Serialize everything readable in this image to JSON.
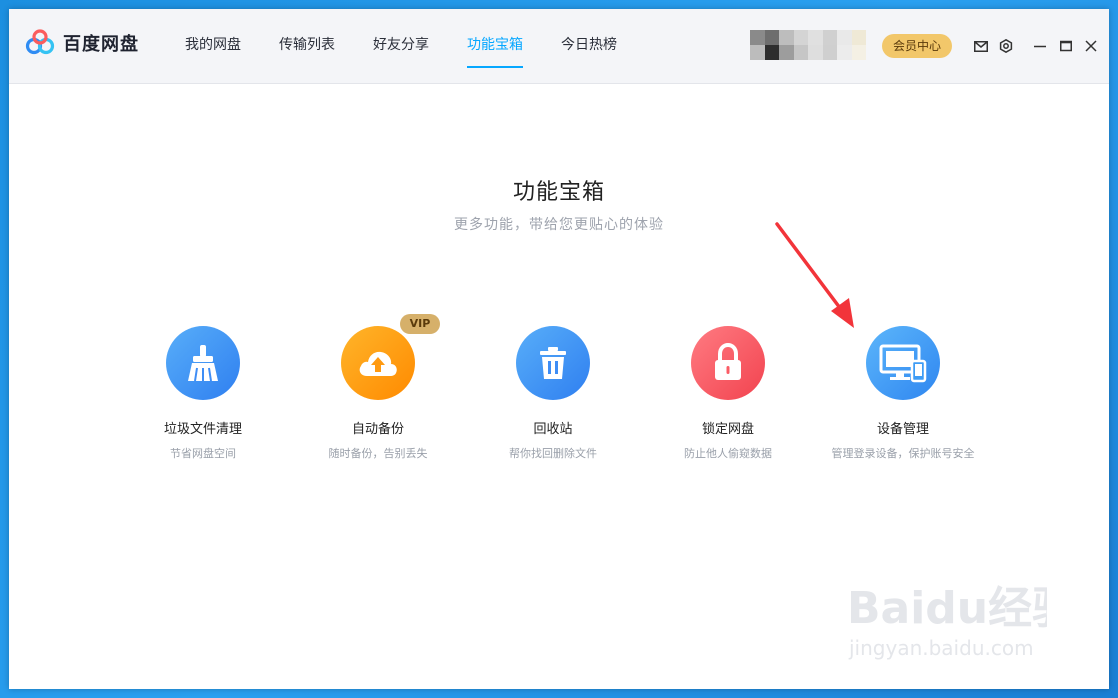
{
  "app": {
    "name": "百度网盘"
  },
  "nav": [
    {
      "label": "我的网盘",
      "active": false
    },
    {
      "label": "传输列表",
      "active": false
    },
    {
      "label": "好友分享",
      "active": false
    },
    {
      "label": "功能宝箱",
      "active": true
    },
    {
      "label": "今日热榜",
      "active": false
    }
  ],
  "header": {
    "vip_center": "会员中心"
  },
  "page": {
    "title": "功能宝箱",
    "subtitle": "更多功能，带给您更贴心的体验"
  },
  "features": [
    {
      "label": "垃圾文件清理",
      "desc": "节省网盘空间",
      "icon": "broom-icon",
      "color": "#3e8df5"
    },
    {
      "label": "自动备份",
      "desc": "随时备份，告别丢失",
      "icon": "cloud-upload-icon",
      "color": "#ff9f0f",
      "badge": "VIP"
    },
    {
      "label": "回收站",
      "desc": "帮你找回删除文件",
      "icon": "trash-icon",
      "color": "#3e8df5"
    },
    {
      "label": "锁定网盘",
      "desc": "防止他人偷窥数据",
      "icon": "lock-icon",
      "color": "#fb5c66"
    },
    {
      "label": "设备管理",
      "desc": "管理登录设备，保护账号安全",
      "icon": "devices-icon",
      "color": "#3e9cf5"
    }
  ],
  "watermark": {
    "brand": "Baidu经验",
    "url": "jingyan.baidu.com"
  },
  "colors": {
    "accent": "#06a7ff",
    "arrow": "#f2343a",
    "vip": "#f2c76a"
  }
}
